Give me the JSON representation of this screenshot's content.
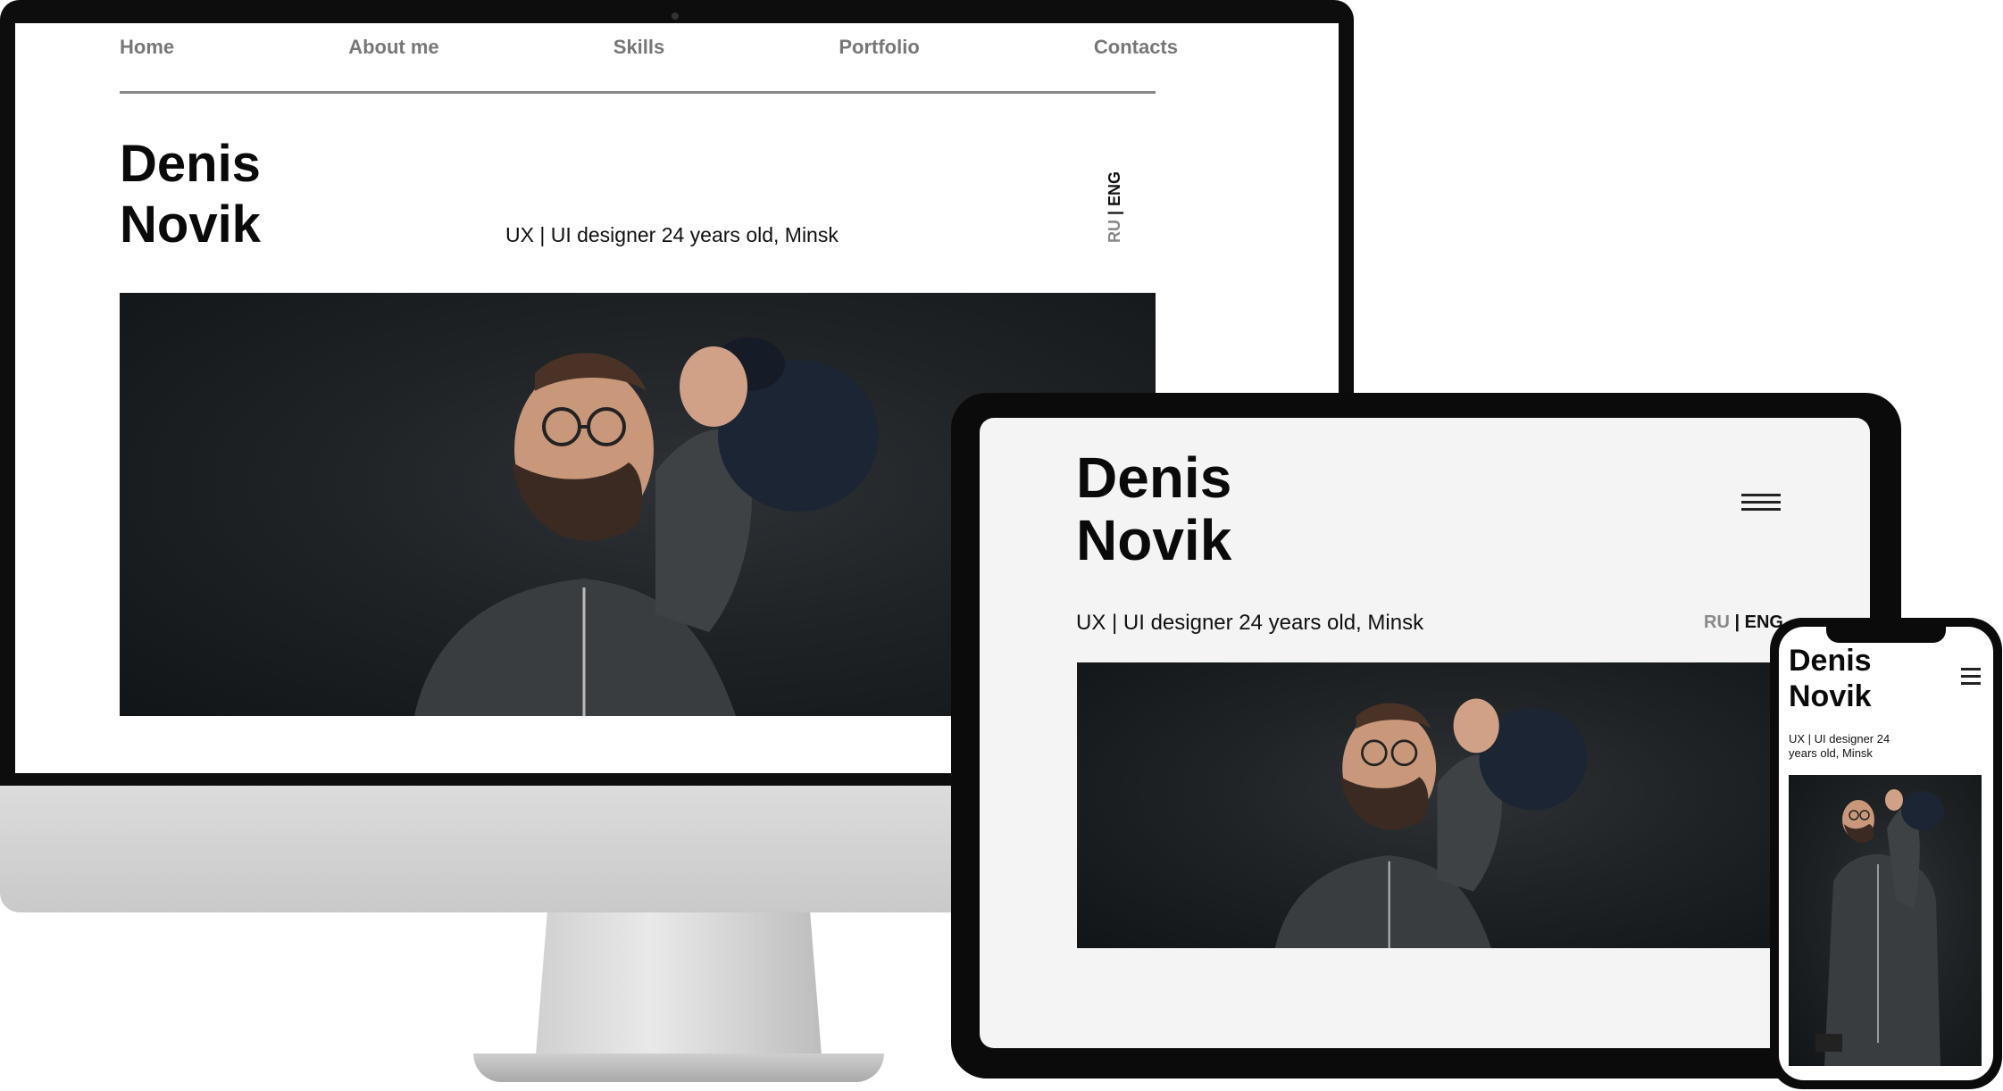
{
  "desktop": {
    "nav": [
      "Home",
      "About me",
      "Skills",
      "Portfolio",
      "Contacts"
    ],
    "name_line1": "Denis",
    "name_line2": "Novik",
    "subtitle": "UX | UI designer 24 years old, Minsk",
    "lang_ru": "RU",
    "lang_sep": " | ",
    "lang_eng": "ENG"
  },
  "tablet": {
    "name_line1": "Denis",
    "name_line2": "Novik",
    "subtitle": "UX | UI designer 24 years old, Minsk",
    "lang_ru": "RU",
    "lang_sep": " | ",
    "lang_eng": "ENG",
    "menu_icon": "hamburger-icon"
  },
  "mobile": {
    "name_line1": "Denis",
    "name_line2": "Novik",
    "subtitle": "UX | UI designer 24 years old, Minsk",
    "menu_icon": "hamburger-icon"
  },
  "colors": {
    "nav_text": "#777777",
    "heading": "#0a0a0a",
    "photo_bg": "#1f2326",
    "device_frame": "#0b0b0b",
    "tablet_screen": "#f4f4f4"
  }
}
